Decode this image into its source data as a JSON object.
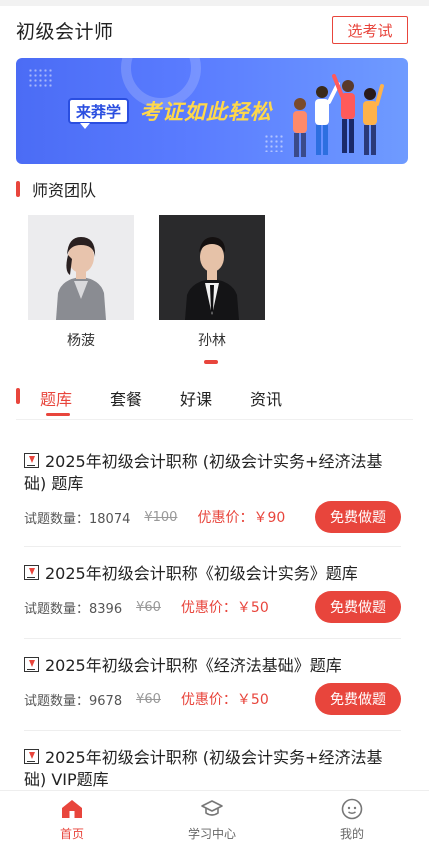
{
  "header": {
    "title": "初级会计师",
    "select_exam": "选考试"
  },
  "banner": {
    "brand": "来莽学",
    "slogan": "考证如此轻松"
  },
  "teachers_section": {
    "title": "师资团队"
  },
  "teachers": [
    {
      "name": "杨菠"
    },
    {
      "name": "孙林"
    }
  ],
  "tabs": [
    {
      "label": "题库"
    },
    {
      "label": "套餐"
    },
    {
      "label": "好课"
    },
    {
      "label": "资讯"
    }
  ],
  "items": [
    {
      "title": "2025年初级会计职称 (初级会计实务+经济法基础) 题库",
      "count": "试题数量：18074",
      "orig": "¥100",
      "deal": "优惠价：￥90",
      "button": "免费做题"
    },
    {
      "title": "2025年初级会计职称《初级会计实务》题库",
      "count": "试题数量：8396",
      "orig": "¥60",
      "deal": "优惠价：￥50",
      "button": "免费做题"
    },
    {
      "title": "2025年初级会计职称《经济法基础》题库",
      "count": "试题数量：9678",
      "orig": "¥60",
      "deal": "优惠价：￥50",
      "button": "免费做题"
    },
    {
      "title": "2025年初级会计职称 (初级会计实务+经济法基础) VIP题库"
    }
  ],
  "nav": [
    {
      "label": "首页"
    },
    {
      "label": "学习中心"
    },
    {
      "label": "我的"
    }
  ],
  "colors": {
    "accent": "#e8453c",
    "banner": "#5a7cff",
    "slogan": "#ffd84a"
  }
}
